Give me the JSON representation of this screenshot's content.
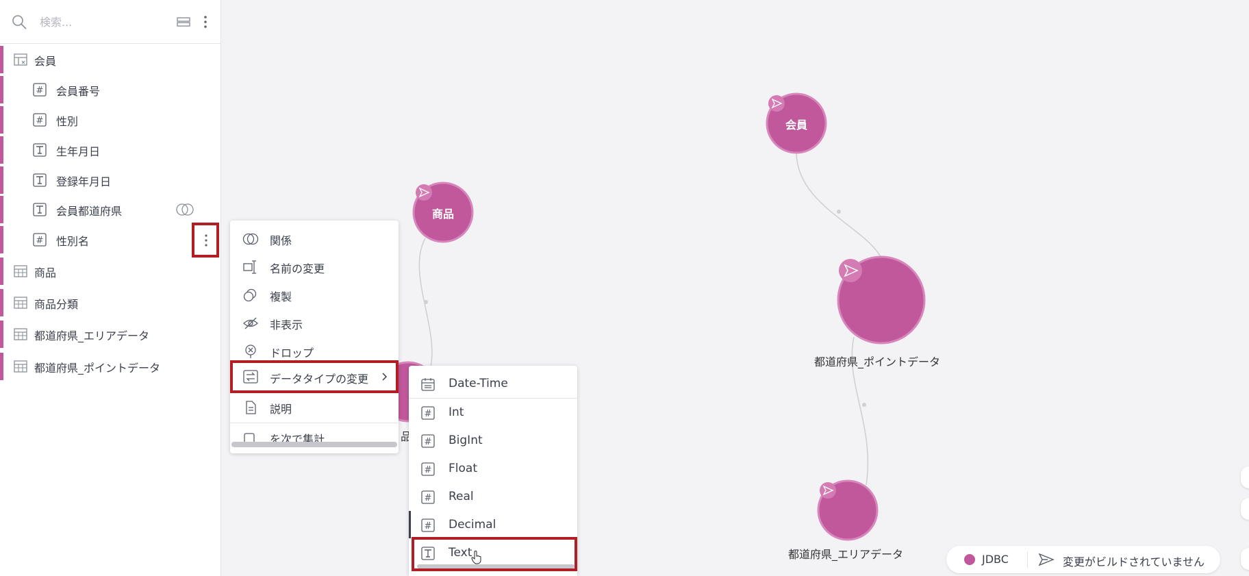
{
  "search": {
    "placeholder": "検索..."
  },
  "sidebar": {
    "tables": [
      {
        "label": "会員",
        "columns": [
          {
            "label": "会員番号",
            "type": "number"
          },
          {
            "label": "性別",
            "type": "number"
          },
          {
            "label": "生年月日",
            "type": "text"
          },
          {
            "label": "登録年月日",
            "type": "text"
          },
          {
            "label": "会員都道府県",
            "type": "text"
          },
          {
            "label": "性別名",
            "type": "number"
          }
        ]
      },
      {
        "label": "商品"
      },
      {
        "label": "商品分類"
      },
      {
        "label": "都道府県_エリアデータ"
      },
      {
        "label": "都道府県_ポイントデータ"
      }
    ]
  },
  "graph": {
    "nodes": {
      "member": "会員",
      "product": "商品",
      "point_data": "都道府県_ポイントデータ",
      "area_data": "都道府県_エリアデータ",
      "partial_label": "品"
    }
  },
  "context_menu": {
    "items": [
      "関係",
      "名前の変更",
      "複製",
      "非表示",
      "ドロップ",
      "データタイプの変更",
      "説明",
      "を次で集計"
    ]
  },
  "datatype_submenu": {
    "items": [
      "Date-Time",
      "Int",
      "BigInt",
      "Float",
      "Real",
      "Decimal",
      "Text"
    ]
  },
  "status": {
    "connection": "JDBC",
    "build_message": "変更がビルドされていません"
  },
  "colors": {
    "node": "#c0589b",
    "node_border": "#d787bb",
    "highlight": "#b11f24",
    "accent_bar": "#c0589b"
  }
}
